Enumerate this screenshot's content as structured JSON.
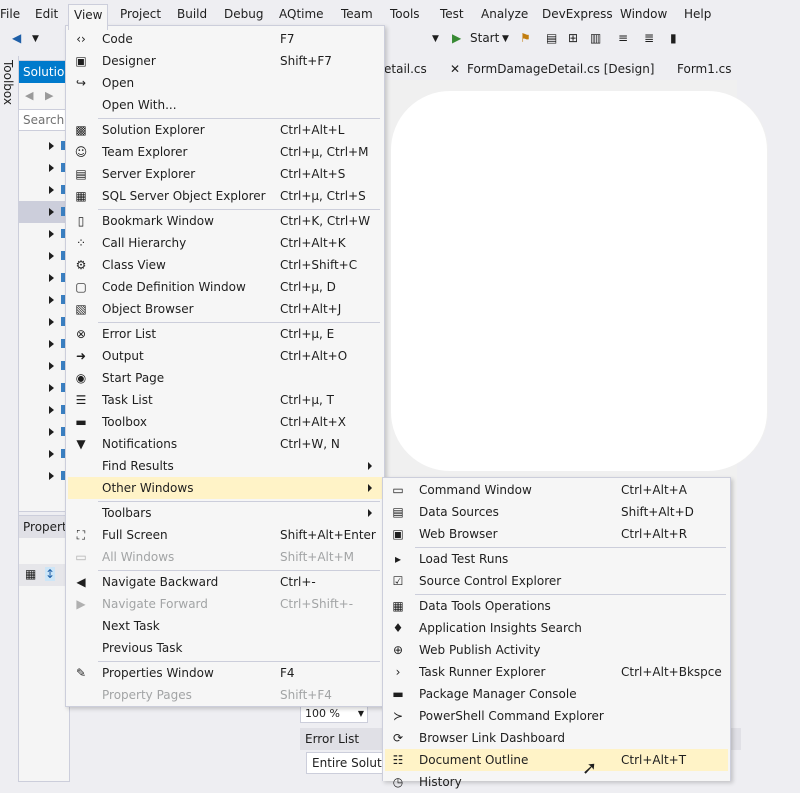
{
  "menubar": [
    "File",
    "Edit",
    "View",
    "Project",
    "Build",
    "Debug",
    "AQtime",
    "Team",
    "Tools",
    "Test",
    "Analyze",
    "DevExpress",
    "Window",
    "Help"
  ],
  "toolbar": {
    "start_label": "Start"
  },
  "toolbox": {
    "label": "Toolbox"
  },
  "solution_explorer": {
    "title": "Solution Explorer",
    "search_placeholder": "Search Solution Explorer"
  },
  "properties": {
    "title": "Properties"
  },
  "doc_tabs": [
    "etail.cs",
    "FormDamageDetail.cs [Design]",
    "Form1.cs"
  ],
  "zoom": "100 %",
  "error_list": {
    "title": "Error List",
    "scope": "Entire Solution"
  },
  "view_menu": [
    {
      "label": "Code",
      "shortcut": "F7",
      "icon": "code-icon"
    },
    {
      "label": "Designer",
      "shortcut": "Shift+F7",
      "icon": "designer-icon"
    },
    {
      "label": "Open",
      "shortcut": "",
      "icon": "open-icon"
    },
    {
      "label": "Open With...",
      "shortcut": "",
      "icon": ""
    },
    {
      "sep": true
    },
    {
      "label": "Solution Explorer",
      "shortcut": "Ctrl+Alt+L",
      "icon": "solution-explorer-icon"
    },
    {
      "label": "Team Explorer",
      "shortcut": "Ctrl+µ, Ctrl+M",
      "icon": "team-explorer-icon"
    },
    {
      "label": "Server Explorer",
      "shortcut": "Ctrl+Alt+S",
      "icon": "server-explorer-icon"
    },
    {
      "label": "SQL Server Object Explorer",
      "shortcut": "Ctrl+µ, Ctrl+S",
      "icon": "sql-server-icon"
    },
    {
      "sep": true
    },
    {
      "label": "Bookmark Window",
      "shortcut": "Ctrl+K, Ctrl+W",
      "icon": "bookmark-icon"
    },
    {
      "label": "Call Hierarchy",
      "shortcut": "Ctrl+Alt+K",
      "icon": "call-hierarchy-icon"
    },
    {
      "label": "Class View",
      "shortcut": "Ctrl+Shift+C",
      "icon": "class-view-icon"
    },
    {
      "label": "Code Definition Window",
      "shortcut": "Ctrl+µ, D",
      "icon": "code-definition-icon"
    },
    {
      "label": "Object Browser",
      "shortcut": "Ctrl+Alt+J",
      "icon": "object-browser-icon"
    },
    {
      "sep": true
    },
    {
      "label": "Error List",
      "shortcut": "Ctrl+µ, E",
      "icon": "error-list-icon"
    },
    {
      "label": "Output",
      "shortcut": "Ctrl+Alt+O",
      "icon": "output-icon"
    },
    {
      "label": "Start Page",
      "shortcut": "",
      "icon": "start-page-icon"
    },
    {
      "label": "Task List",
      "shortcut": "Ctrl+µ, T",
      "icon": "task-list-icon"
    },
    {
      "label": "Toolbox",
      "shortcut": "Ctrl+Alt+X",
      "icon": "toolbox-icon"
    },
    {
      "label": "Notifications",
      "shortcut": "Ctrl+W, N",
      "icon": "notifications-icon"
    },
    {
      "label": "Find Results",
      "shortcut": "",
      "icon": "",
      "submenu": true
    },
    {
      "label": "Other Windows",
      "shortcut": "",
      "icon": "",
      "submenu": true,
      "highlighted": true
    },
    {
      "sep": true
    },
    {
      "label": "Toolbars",
      "shortcut": "",
      "icon": "",
      "submenu": true
    },
    {
      "label": "Full Screen",
      "shortcut": "Shift+Alt+Enter",
      "icon": "full-screen-icon"
    },
    {
      "label": "All Windows",
      "shortcut": "Shift+Alt+M",
      "icon": "all-windows-icon",
      "disabled": true
    },
    {
      "sep": true
    },
    {
      "label": "Navigate Backward",
      "shortcut": "Ctrl+-",
      "icon": "navigate-backward-icon"
    },
    {
      "label": "Navigate Forward",
      "shortcut": "Ctrl+Shift+-",
      "icon": "navigate-forward-icon",
      "disabled": true
    },
    {
      "label": "Next Task",
      "shortcut": "",
      "icon": ""
    },
    {
      "label": "Previous Task",
      "shortcut": "",
      "icon": ""
    },
    {
      "sep": true
    },
    {
      "label": "Properties Window",
      "shortcut": "F4",
      "icon": "wrench-icon"
    },
    {
      "label": "Property Pages",
      "shortcut": "Shift+F4",
      "icon": "",
      "disabled": true
    }
  ],
  "other_windows_menu": [
    {
      "label": "Command Window",
      "shortcut": "Ctrl+Alt+A",
      "icon": "command-window-icon"
    },
    {
      "label": "Data Sources",
      "shortcut": "Shift+Alt+D",
      "icon": "data-sources-icon"
    },
    {
      "label": "Web Browser",
      "shortcut": "Ctrl+Alt+R",
      "icon": "web-browser-icon"
    },
    {
      "sep": true
    },
    {
      "label": "Load Test Runs",
      "shortcut": "",
      "icon": "load-test-icon"
    },
    {
      "label": "Source Control Explorer",
      "shortcut": "",
      "icon": "source-control-icon"
    },
    {
      "sep": true
    },
    {
      "label": "Data Tools Operations",
      "shortcut": "",
      "icon": "data-tools-icon"
    },
    {
      "label": "Application Insights Search",
      "shortcut": "",
      "icon": "insights-icon"
    },
    {
      "label": "Web Publish Activity",
      "shortcut": "",
      "icon": "globe-icon"
    },
    {
      "label": "Task Runner Explorer",
      "shortcut": "Ctrl+Alt+Bkspce",
      "icon": "task-runner-icon"
    },
    {
      "label": "Package Manager Console",
      "shortcut": "",
      "icon": "package-console-icon"
    },
    {
      "label": "PowerShell Command Explorer",
      "shortcut": "",
      "icon": "powershell-icon"
    },
    {
      "label": "Browser Link Dashboard",
      "shortcut": "",
      "icon": "browser-link-icon"
    },
    {
      "label": "Document Outline",
      "shortcut": "Ctrl+Alt+T",
      "icon": "document-outline-icon",
      "highlighted": true
    },
    {
      "label": "History",
      "shortcut": "",
      "icon": "history-icon"
    }
  ]
}
